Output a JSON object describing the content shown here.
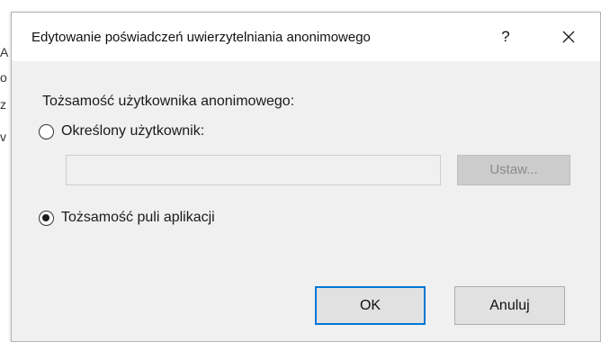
{
  "background_window": {
    "fragments": [
      "A",
      "o",
      "z",
      "v"
    ]
  },
  "dialog": {
    "title": "Edytowanie poświadczeń uwierzytelniania anonimowego",
    "help_label": "?",
    "group_label": "Tożsamość użytkownika anonimowego:",
    "options": [
      {
        "label": "Określony użytkownik:",
        "selected": false
      },
      {
        "label": "Tożsamość puli aplikacji",
        "selected": true
      }
    ],
    "user_input": {
      "value": "",
      "placeholder": ""
    },
    "set_button_label": "Ustaw...",
    "ok_label": "OK",
    "cancel_label": "Anuluj"
  }
}
